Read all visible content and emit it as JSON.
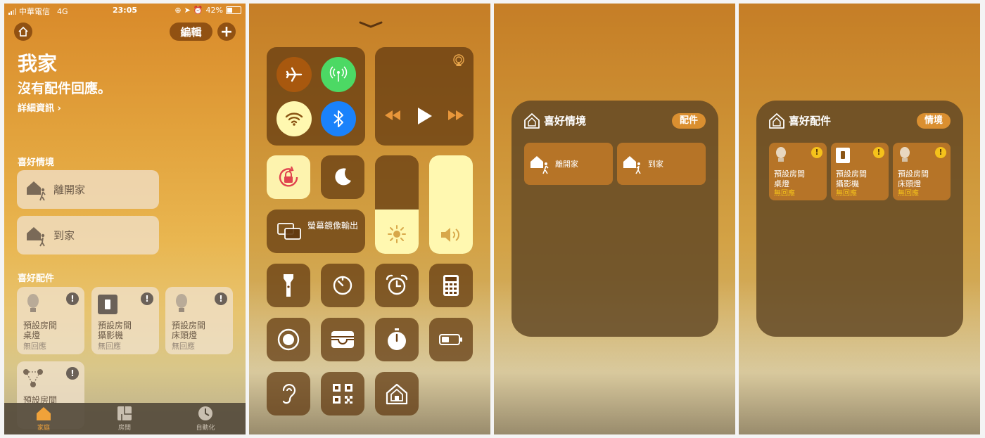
{
  "panel1": {
    "status": {
      "carrier": "中華電信",
      "network": "4G",
      "time": "23:05",
      "battery": "42%",
      "battery_level": 0.42
    },
    "edit_label": "編輯",
    "title": "我家",
    "subtitle": "沒有配件回應。",
    "details_link": "詳細資訊 ›",
    "scenes_header": "喜好情境",
    "scenes": [
      {
        "label": "離開家",
        "icon": "leave-home-icon"
      },
      {
        "label": "到家",
        "icon": "arrive-home-icon"
      }
    ],
    "accessories_header": "喜好配件",
    "accessories": [
      {
        "room": "預設房間",
        "name": "桌燈",
        "status": "無回應",
        "icon": "bulb-icon"
      },
      {
        "room": "預設房間",
        "name": "攝影機",
        "status": "無回應",
        "icon": "switch-icon"
      },
      {
        "room": "預設房間",
        "name": "床頭燈",
        "status": "無回應",
        "icon": "bulb-icon"
      },
      {
        "room": "預設房間",
        "icon": "bridge-icon"
      }
    ],
    "tabs": [
      {
        "label": "家庭",
        "icon": "home-tab-icon",
        "active": true
      },
      {
        "label": "房間",
        "icon": "rooms-tab-icon",
        "active": false
      },
      {
        "label": "自動化",
        "icon": "automation-tab-icon",
        "active": false
      }
    ]
  },
  "panel2": {
    "screen_mirroring_label": "螢幕鏡像輸出",
    "brightness_level": 0.45,
    "volume_level": 1.0,
    "icons": [
      "airplane-icon",
      "cellular-icon",
      "wifi-icon",
      "bluetooth-icon",
      "airplay-icon",
      "rewind-icon",
      "play-icon",
      "fast-forward-icon",
      "rotation-lock-icon",
      "do-not-disturb-icon",
      "brightness-icon",
      "volume-icon",
      "flashlight-icon",
      "timer-icon",
      "alarm-icon",
      "calculator-icon",
      "screen-record-icon",
      "wallet-icon",
      "stopwatch-icon",
      "low-power-icon",
      "hearing-icon",
      "qr-code-icon",
      "home-icon"
    ]
  },
  "panel3": {
    "title": "喜好情境",
    "toggle_label": "配件",
    "scenes": [
      {
        "label": "離開家"
      },
      {
        "label": "到家"
      }
    ]
  },
  "panel4": {
    "title": "喜好配件",
    "toggle_label": "情境",
    "accessories": [
      {
        "room": "預設房間",
        "name": "桌燈",
        "status": "無回應"
      },
      {
        "room": "預設房間",
        "name": "攝影機",
        "status": "無回應"
      },
      {
        "room": "預設房間",
        "name": "床頭燈",
        "status": "無回應"
      }
    ]
  },
  "colors": {
    "accent": "#f0a23a",
    "warning": "#f5c21b",
    "ios_green": "#4cd964",
    "ios_blue": "#1a82fb"
  }
}
